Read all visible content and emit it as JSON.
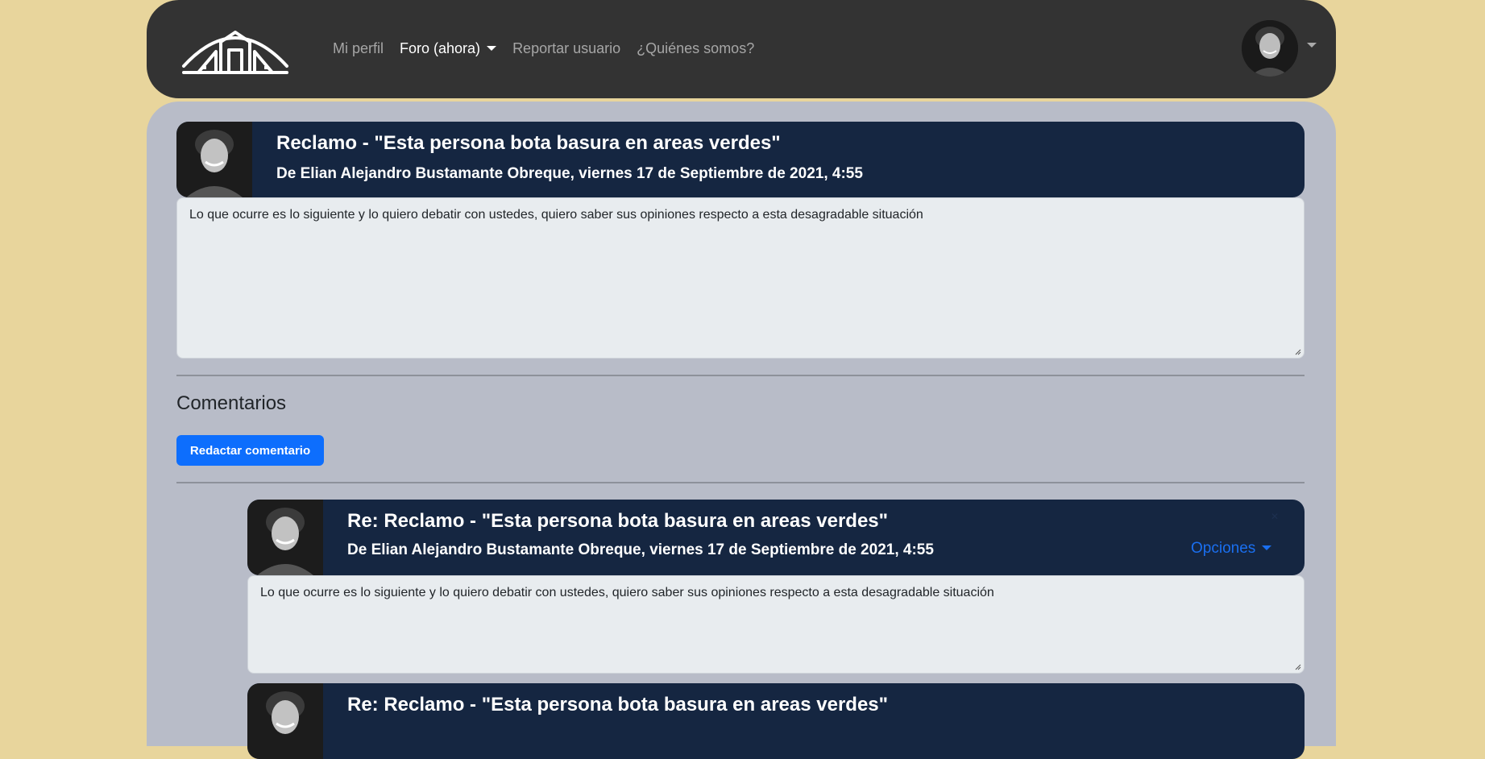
{
  "nav": {
    "logo_alt": "logo",
    "links": [
      {
        "label": "Mi perfil",
        "active": false,
        "dropdown": false
      },
      {
        "label": "Foro (ahora)",
        "active": true,
        "dropdown": true
      },
      {
        "label": "Reportar usuario",
        "active": false,
        "dropdown": false
      },
      {
        "label": "¿Quiénes somos?",
        "active": false,
        "dropdown": false
      }
    ]
  },
  "post": {
    "title": "Reclamo - \"Esta persona bota basura en areas verdes\"",
    "meta": "De Elian Alejandro Bustamante Obreque, viernes 17 de Septiembre de 2021, 4:55",
    "body": "Lo que ocurre es lo siguiente y lo quiero debatir con ustedes, quiero saber sus opiniones respecto a esta desagradable situación"
  },
  "comments_section": {
    "title": "Comentarios",
    "write_button": "Redactar comentario"
  },
  "comments": [
    {
      "title": "Re: Reclamo - \"Esta persona bota basura en areas verdes\"",
      "meta": "De Elian Alejandro Bustamante Obreque, viernes 17 de Septiembre de 2021, 4:55",
      "options_label": "Opciones",
      "body": "Lo que ocurre es lo siguiente y lo quiero debatir con ustedes, quiero saber sus opiniones respecto a esta desagradable situación"
    },
    {
      "title": "Re: Reclamo - \"Esta persona bota basura en areas verdes\""
    }
  ],
  "colors": {
    "page_bg": "#e8d59c",
    "navbar_bg": "#333333",
    "main_bg": "#b8bcc8",
    "post_header_bg": "#152641",
    "primary": "#0d6efd"
  }
}
